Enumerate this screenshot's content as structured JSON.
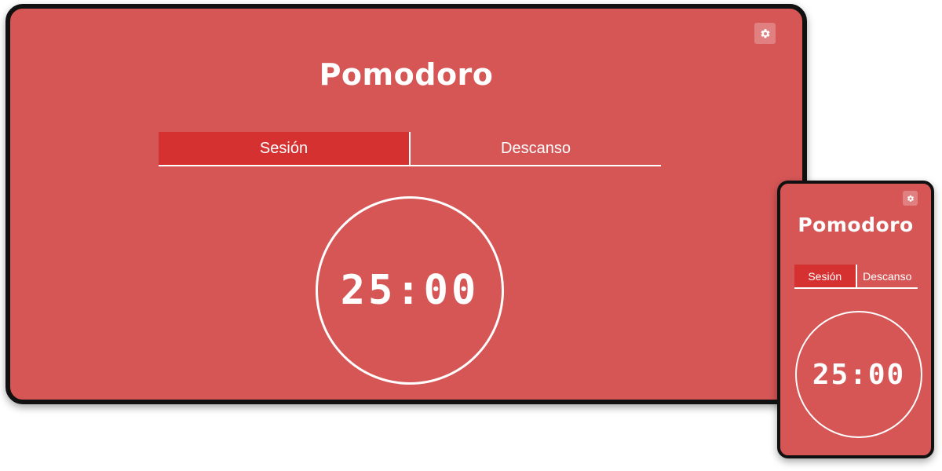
{
  "desktop": {
    "title": "Pomodoro",
    "tabs": [
      {
        "label": "Sesión",
        "active": true
      },
      {
        "label": "Descanso",
        "active": false
      }
    ],
    "timer": "25:00",
    "settings_icon": "gear-icon"
  },
  "mobile": {
    "title": "Pomodoro",
    "tabs": [
      {
        "label": "Sesión",
        "active": true
      },
      {
        "label": "Descanso",
        "active": false
      }
    ],
    "timer": "25:00",
    "settings_icon": "gear-icon"
  },
  "colors": {
    "background": "#d65656",
    "active_tab": "#d63131",
    "foreground": "#ffffff",
    "bezel": "#111111"
  }
}
